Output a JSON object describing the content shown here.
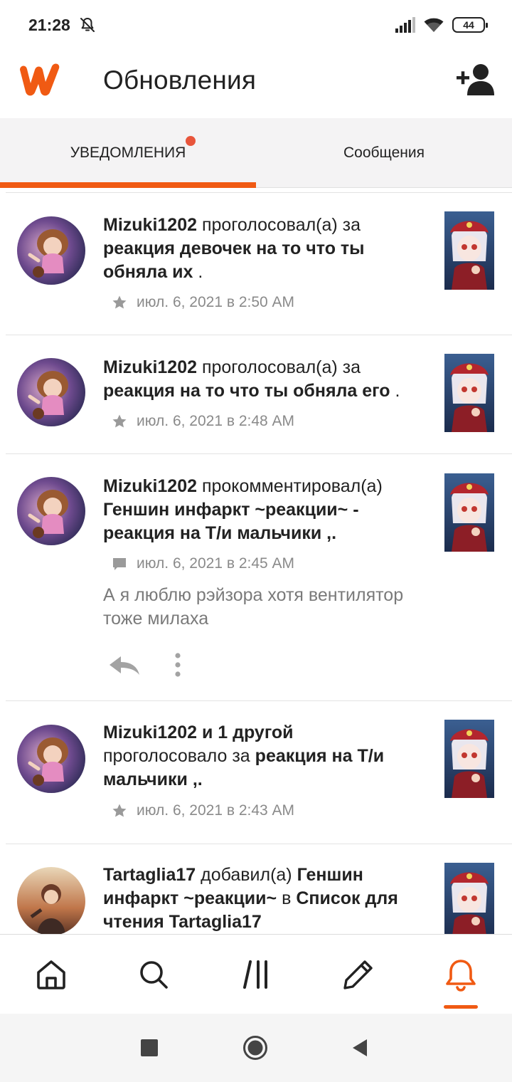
{
  "status_bar": {
    "time": "21:28",
    "battery": "44"
  },
  "header": {
    "title": "Обновления"
  },
  "tabs": [
    {
      "label": "УВЕДОМЛЕНИЯ",
      "active": true,
      "has_badge": true
    },
    {
      "label": "Сообщения",
      "active": false,
      "has_badge": false
    }
  ],
  "notifications": [
    {
      "user": "Mizuki1202",
      "action": " проголосовал(а) за ",
      "story": "реакция девочек на то что ты обняла их",
      "suffix": " .",
      "meta_icon": "star-icon",
      "timestamp": "июл. 6, 2021 в 2:50 AM"
    },
    {
      "user": "Mizuki1202",
      "action": " проголосовал(а) за ",
      "story": "реакция на то что ты обняла его",
      "suffix": " .",
      "meta_icon": "star-icon",
      "timestamp": "июл. 6, 2021 в 2:48 AM"
    },
    {
      "user": "Mizuki1202",
      "action": " прокомментировал(а) ",
      "story": "Геншин инфаркт ~реакции~ - реакция на Т/и мальчики ,.",
      "suffix": "",
      "meta_icon": "comment-icon",
      "timestamp": "июл. 6, 2021 в 2:45 AM",
      "comment": "А я люблю рэйзора хотя вентилятор тоже милаха"
    },
    {
      "user": "Mizuki1202 и 1 другой",
      "action": " проголосовало за ",
      "story": "реакция на Т/и мальчики ,.",
      "suffix": "",
      "meta_icon": "star-icon",
      "timestamp": "июл. 6, 2021 в 2:43 AM"
    },
    {
      "user": "Tartaglia17",
      "action": " добавил(а) ",
      "story": "Геншин инфаркт ~реакции~",
      "mid": " в ",
      "list": "Список для чтения Tartaglia17",
      "suffix": ""
    }
  ],
  "bottom_nav": [
    {
      "name": "home-icon",
      "active": false
    },
    {
      "name": "search-icon",
      "active": false
    },
    {
      "name": "library-icon",
      "active": false
    },
    {
      "name": "write-icon",
      "active": false
    },
    {
      "name": "notifications-bell-icon",
      "active": true
    }
  ],
  "colors": {
    "accent": "#f05a13",
    "badge": "#e8553b",
    "tab_bar_bg": "#f4f3f4"
  }
}
